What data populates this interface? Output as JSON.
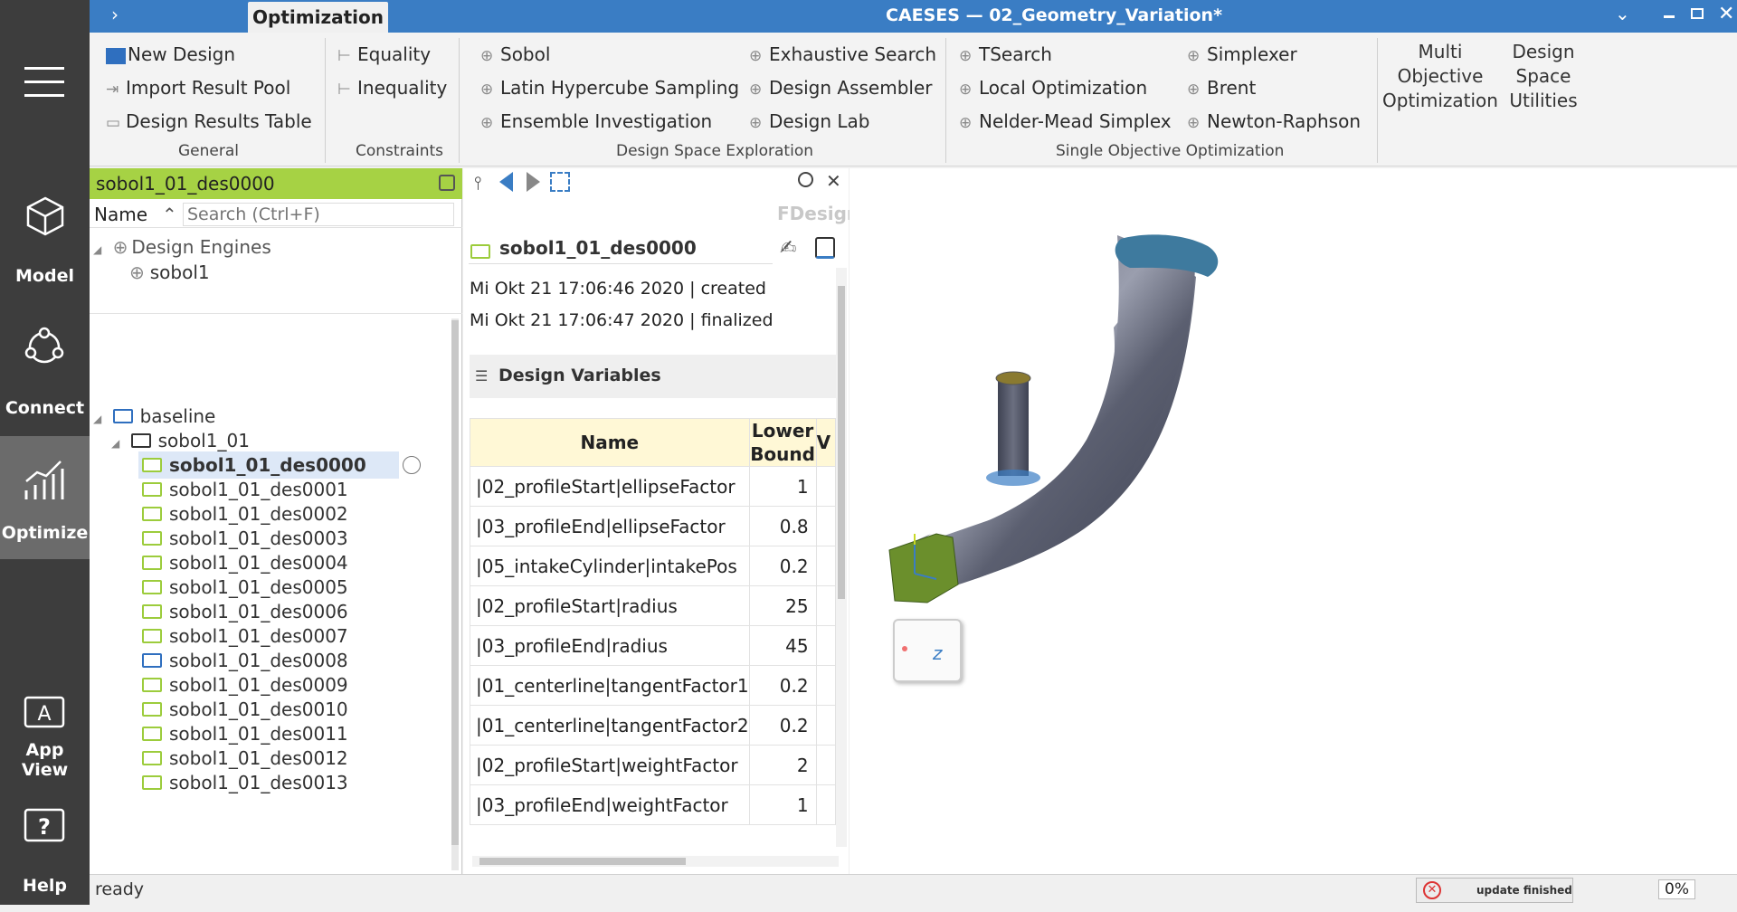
{
  "sidebar": {
    "items": [
      {
        "label": "Model",
        "icon": "cube-icon"
      },
      {
        "label": "Connect",
        "icon": "connect-icon"
      },
      {
        "label": "Optimize",
        "icon": "chart-icon"
      },
      {
        "label": "App View",
        "icon": "app-view-icon"
      },
      {
        "label": "Help",
        "icon": "help-icon"
      }
    ]
  },
  "titlebar": {
    "active_tab": "Optimization",
    "window_title": "CAESES — 02_Geometry_Variation*"
  },
  "ribbon": {
    "general": {
      "label": "General",
      "items": [
        "New Design",
        "Import Result Pool",
        "Design Results Table"
      ]
    },
    "constraints": {
      "label": "Constraints",
      "items": [
        "Equality",
        "Inequality"
      ]
    },
    "exploration": {
      "label": "Design Space Exploration",
      "col1": [
        "Sobol",
        "Latin Hypercube Sampling",
        "Ensemble Investigation"
      ],
      "col2": [
        "Exhaustive Search",
        "Design Assembler",
        "Design Lab"
      ]
    },
    "single_objective": {
      "label": "Single Objective Optimization",
      "col1": [
        "TSearch",
        "Local Optimization",
        "Nelder-Mead Simplex"
      ],
      "col2": [
        "Simplexer",
        "Brent",
        "Newton-Raphson"
      ]
    },
    "multi_objective": "Multi Objective Optimization",
    "design_space": "Design Space Utilities"
  },
  "tree": {
    "header": "sobol1_01_des0000",
    "name_label": "Name",
    "search_placeholder": "Search (Ctrl+F)",
    "engines_label": "Design Engines",
    "engine": "sobol1",
    "baseline": "baseline",
    "group": "sobol1_01",
    "designs": [
      "sobol1_01_des0000",
      "sobol1_01_des0001",
      "sobol1_01_des0002",
      "sobol1_01_des0003",
      "sobol1_01_des0004",
      "sobol1_01_des0005",
      "sobol1_01_des0006",
      "sobol1_01_des0007",
      "sobol1_01_des0008",
      "sobol1_01_des0009",
      "sobol1_01_des0010",
      "sobol1_01_des0011",
      "sobol1_01_des0012",
      "sobol1_01_des0013"
    ]
  },
  "details": {
    "watermark": "FDesign",
    "design_name": "sobol1_01_des0000",
    "created": "Mi Okt 21 17:06:46 2020 | created",
    "finalized": "Mi Okt 21 17:06:47 2020 | finalized",
    "section_title": "Design Variables",
    "columns": [
      "Name",
      "Lower Bound",
      "V"
    ],
    "rows": [
      {
        "name": "|02_profileStart|ellipseFactor",
        "lower": "1"
      },
      {
        "name": "|03_profileEnd|ellipseFactor",
        "lower": "0.8"
      },
      {
        "name": "|05_intakeCylinder|intakePos",
        "lower": "0.2"
      },
      {
        "name": "|02_profileStart|radius",
        "lower": "25"
      },
      {
        "name": "|03_profileEnd|radius",
        "lower": "45"
      },
      {
        "name": "|01_centerline|tangentFactor1",
        "lower": "0.2"
      },
      {
        "name": "|01_centerline|tangentFactor2",
        "lower": "0.2"
      },
      {
        "name": "|02_profileStart|weightFactor",
        "lower": "2"
      },
      {
        "name": "|03_profileEnd|weightFactor",
        "lower": "1"
      }
    ]
  },
  "viewport": {
    "cube_label": "z"
  },
  "status": {
    "text": "ready",
    "update": "update finished",
    "progress": "0%"
  }
}
